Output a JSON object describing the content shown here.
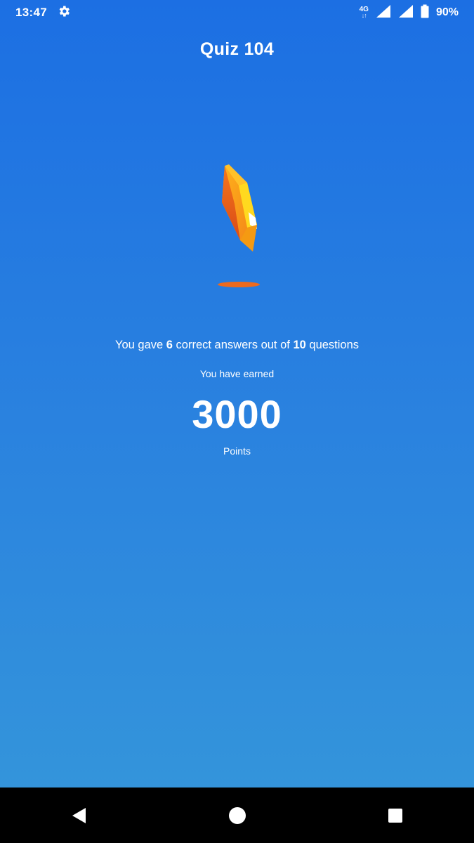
{
  "status_bar": {
    "time": "13:47",
    "settings_icon": "gear-icon",
    "network_type": "4G",
    "network_arrows": "↓↑",
    "battery": "90%"
  },
  "quiz": {
    "title": "Quiz 104",
    "result_prefix": "You gave ",
    "correct_count": "6",
    "result_middle": " correct answers out of ",
    "total_questions": "10",
    "result_suffix": " questions",
    "earned_label": "You have earned",
    "points_value": "3000",
    "points_label": "Points"
  },
  "gem": {
    "icon": "crystal-gem-icon",
    "colors": {
      "primary": "#f7a11a",
      "dark": "#e8561a",
      "light": "#ffd21c",
      "highlight": "#ffffff",
      "shadow": "#ec6a1e"
    }
  },
  "nav_bar": {
    "back_icon": "back-triangle-icon",
    "home_icon": "home-circle-icon",
    "recents_icon": "recents-square-icon"
  },
  "theme": {
    "gradient_top": "#1c6fe3",
    "gradient_bottom": "#3597da",
    "nav_background": "#000000"
  }
}
